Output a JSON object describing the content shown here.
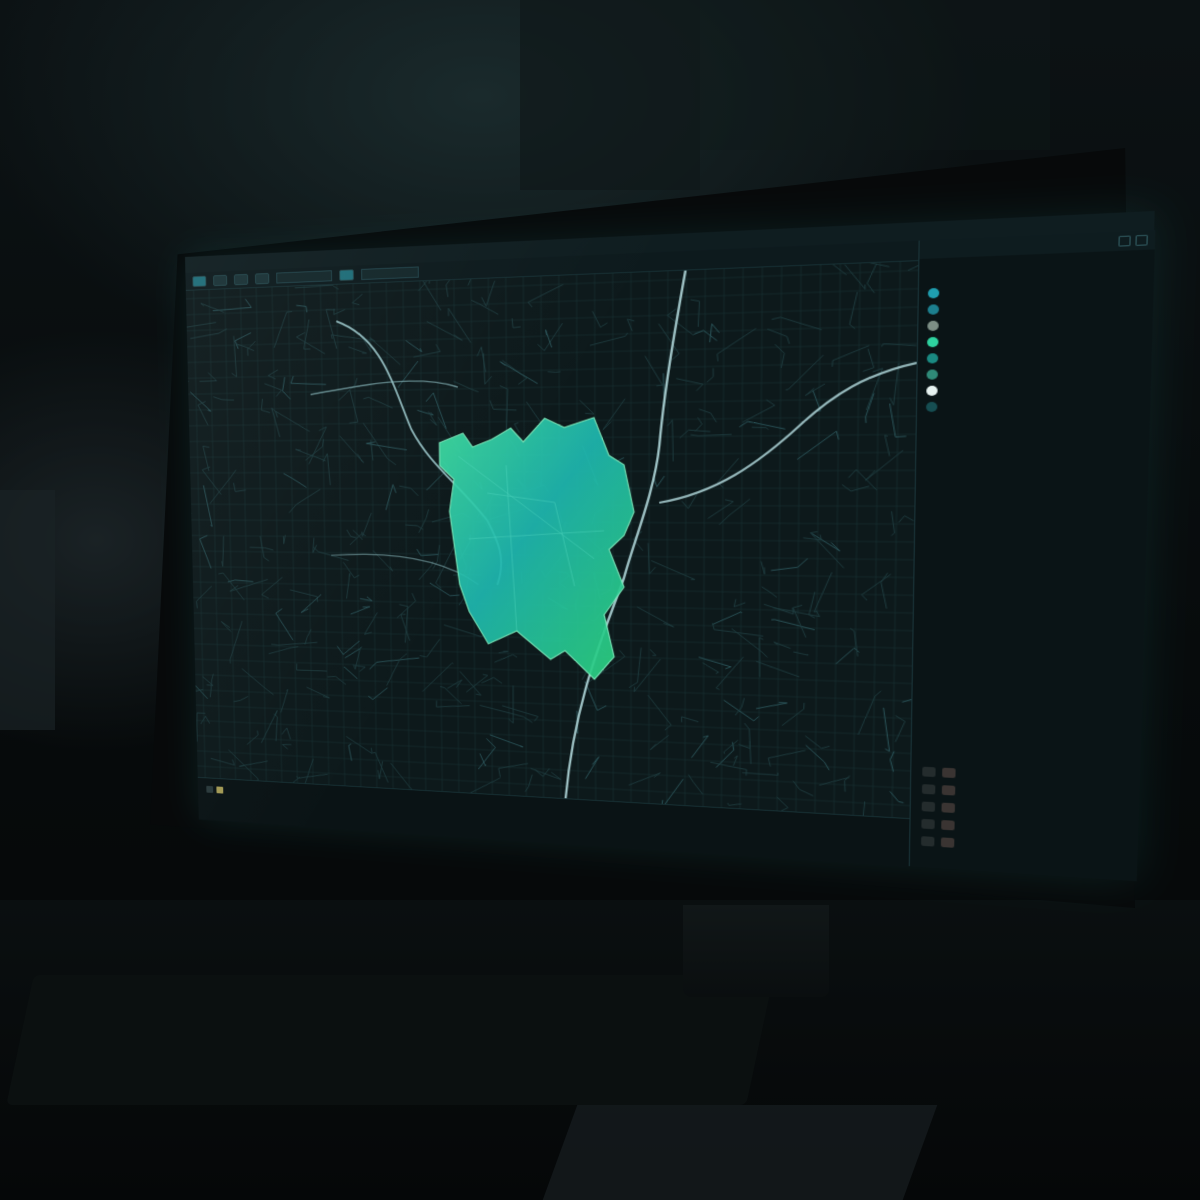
{
  "colors": {
    "accent": "#1fb8a8",
    "selection": "#2ed3a0",
    "background": "#0c1719"
  },
  "app": {
    "title": ""
  },
  "menu": {
    "items": [
      "",
      "",
      "",
      ""
    ]
  },
  "toolbar": {
    "icons": [
      "pan-icon",
      "zoom-icon",
      "select-icon",
      "measure-icon",
      "layers-icon"
    ]
  },
  "map": {
    "labels": [
      {
        "id": "region-label-1",
        "text": ""
      },
      {
        "id": "region-label-2",
        "text": ""
      },
      {
        "id": "region-label-3",
        "text": ""
      }
    ]
  },
  "panel": {
    "title": "",
    "subtitle_1": "",
    "subtitle_2": "",
    "section_title": "",
    "layers": [
      {
        "name": "",
        "color": "#1f9fb0"
      },
      {
        "name": "",
        "color": "#1c7f8e"
      },
      {
        "name": "",
        "color": "#7d8f86"
      },
      {
        "name": "",
        "color": "#2ed3a0"
      },
      {
        "name": "",
        "color": "#1a8a82"
      },
      {
        "name": "",
        "color": "#2f8a78"
      },
      {
        "name": "",
        "color": "#e6f2f0"
      },
      {
        "name": "",
        "color": "#164e52"
      }
    ]
  },
  "legend": {
    "title": "",
    "rows": [
      {
        "name": ""
      },
      {
        "name": ""
      },
      {
        "name": ""
      },
      {
        "name": ""
      },
      {
        "name": ""
      }
    ]
  },
  "status": {
    "left_text": "",
    "mid_text": ""
  }
}
